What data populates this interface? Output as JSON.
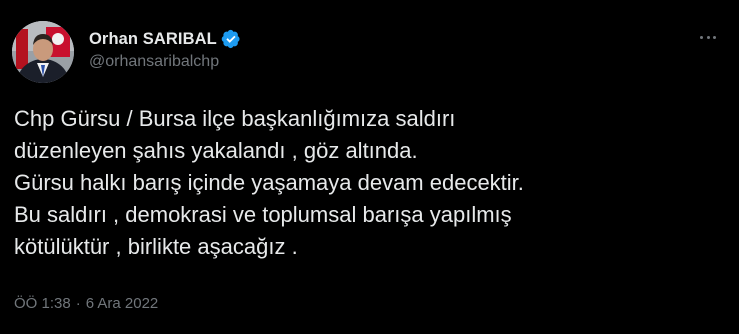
{
  "author": {
    "display_name": "Orhan SARIBAL",
    "handle": "@orhansaribalchp",
    "verified": true
  },
  "tweet": {
    "lines": [
      "Chp Gürsu / Bursa ilçe başkanlığımıza saldırı",
      "düzenleyen şahıs yakalandı , göz altında.",
      "Gürsu halkı barış içinde yaşamaya devam edecektir.",
      "Bu saldırı , demokrasi ve toplumsal barışa yapılmış",
      "kötülüktür , birlikte aşacağız ."
    ]
  },
  "meta": {
    "time": "ÖÖ 1:38",
    "separator": "·",
    "date": "6 Ara 2022"
  },
  "icons": {
    "verified": "verified-badge-icon",
    "more": "more-options-icon"
  },
  "colors": {
    "background": "#000000",
    "text": "#e7e9ea",
    "muted": "#71767b",
    "verified": "#1d9bf0"
  }
}
